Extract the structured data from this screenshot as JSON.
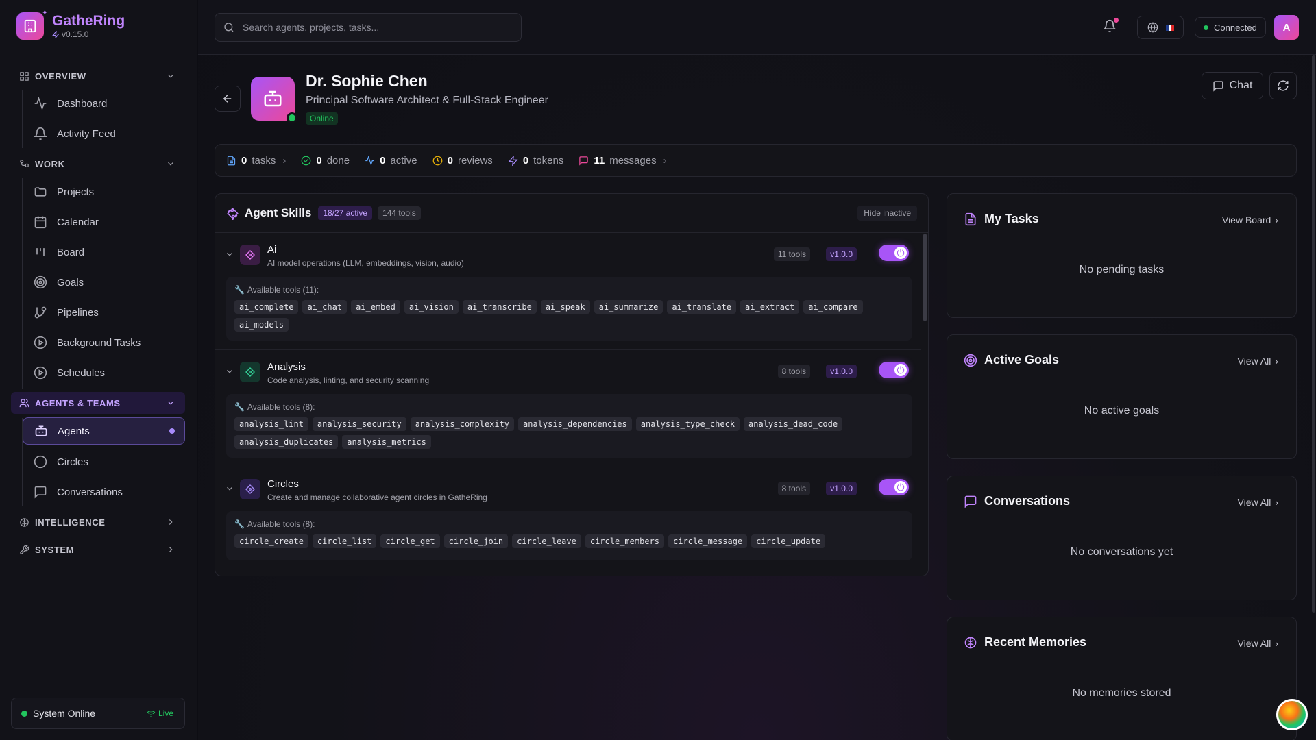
{
  "brand": {
    "name": "GatheRing",
    "version": "v0.15.0"
  },
  "sidebar": {
    "sections": [
      {
        "label": "OVERVIEW",
        "icon": "grid-icon"
      },
      {
        "label": "WORK",
        "icon": "workflow-icon"
      },
      {
        "label": "AGENTS & TEAMS",
        "icon": "users-icon"
      },
      {
        "label": "INTELLIGENCE",
        "icon": "brain-icon"
      },
      {
        "label": "SYSTEM",
        "icon": "wrench-icon"
      }
    ],
    "items": [
      {
        "label": "Dashboard",
        "icon": "activity-icon"
      },
      {
        "label": "Activity Feed",
        "icon": "bell-icon"
      },
      {
        "label": "Projects",
        "icon": "folder-icon"
      },
      {
        "label": "Calendar",
        "icon": "calendar-icon"
      },
      {
        "label": "Board",
        "icon": "kanban-icon"
      },
      {
        "label": "Goals",
        "icon": "target-icon"
      },
      {
        "label": "Pipelines",
        "icon": "git-branch-icon"
      },
      {
        "label": "Background Tasks",
        "icon": "play-circle-icon"
      },
      {
        "label": "Schedules",
        "icon": "play-circle-icon"
      },
      {
        "label": "Agents",
        "icon": "bot-icon",
        "active": true
      },
      {
        "label": "Circles",
        "icon": "circle-icon"
      },
      {
        "label": "Conversations",
        "icon": "message-icon"
      }
    ],
    "status": {
      "label": "System Online",
      "live": "Live"
    }
  },
  "topbar": {
    "search_placeholder": "Search agents, projects, tasks...",
    "connection": "Connected",
    "avatar": "A"
  },
  "agent": {
    "name": "Dr. Sophie Chen",
    "role": "Principal Software Architect & Full-Stack Engineer",
    "status": "Online",
    "chat_label": "Chat"
  },
  "stats": [
    {
      "value": "0",
      "label": "tasks",
      "color": "#60a5fa"
    },
    {
      "value": "0",
      "label": "done",
      "color": "#22c55e"
    },
    {
      "value": "0",
      "label": "active",
      "color": "#60a5fa"
    },
    {
      "value": "0",
      "label": "reviews",
      "color": "#eab308"
    },
    {
      "value": "0",
      "label": "tokens",
      "color": "#a78bfa"
    },
    {
      "value": "11",
      "label": "messages",
      "color": "#ec4899"
    }
  ],
  "skills": {
    "title": "Agent Skills",
    "active": "18/27 active",
    "tools": "144 tools",
    "hide": "Hide inactive",
    "list": [
      {
        "name": "Ai",
        "desc": "AI model operations (LLM, embeddings, vision, audio)",
        "count": "11 tools",
        "version": "v1.0.0",
        "tools_label": "Available tools (11):",
        "tools": [
          "ai_complete",
          "ai_chat",
          "ai_embed",
          "ai_vision",
          "ai_transcribe",
          "ai_speak",
          "ai_summarize",
          "ai_translate",
          "ai_extract",
          "ai_compare",
          "ai_models"
        ]
      },
      {
        "name": "Analysis",
        "desc": "Code analysis, linting, and security scanning",
        "count": "8 tools",
        "version": "v1.0.0",
        "tools_label": "Available tools (8):",
        "tools": [
          "analysis_lint",
          "analysis_security",
          "analysis_complexity",
          "analysis_dependencies",
          "analysis_type_check",
          "analysis_dead_code",
          "analysis_duplicates",
          "analysis_metrics"
        ]
      },
      {
        "name": "Circles",
        "desc": "Create and manage collaborative agent circles in GatheRing",
        "count": "8 tools",
        "version": "v1.0.0",
        "tools_label": "Available tools (8):",
        "tools": [
          "circle_create",
          "circle_list",
          "circle_get",
          "circle_join",
          "circle_leave",
          "circle_members",
          "circle_message",
          "circle_update"
        ]
      }
    ]
  },
  "cards": [
    {
      "title": "My Tasks",
      "link": "View Board",
      "empty": "No pending tasks",
      "icon": "file-icon"
    },
    {
      "title": "Active Goals",
      "link": "View All",
      "empty": "No active goals",
      "icon": "target-icon"
    },
    {
      "title": "Conversations",
      "link": "View All",
      "empty": "No conversations yet",
      "icon": "message-icon"
    },
    {
      "title": "Recent Memories",
      "link": "View All",
      "empty": "No memories stored",
      "icon": "brain-icon"
    }
  ]
}
